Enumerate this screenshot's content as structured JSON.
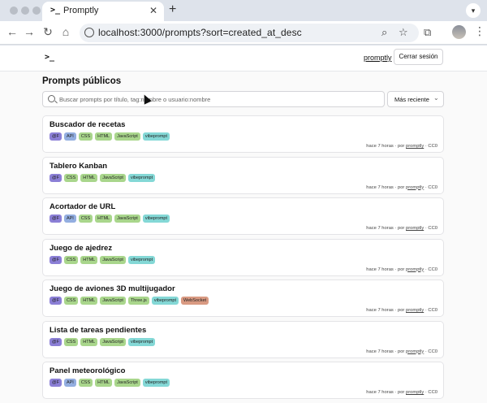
{
  "browser": {
    "tab_title": "Promptly",
    "tab_favicon": ">_",
    "url": "localhost:3000/prompts?sort=created_at_desc"
  },
  "header": {
    "logo": ">_",
    "user_link": "promptly",
    "logout_label": "Cerrar sesión"
  },
  "main": {
    "title": "Prompts públicos",
    "search_placeholder": "Buscar prompts por título, tag:nombre o usuario:nombre",
    "sort_label": "Más reciente"
  },
  "tag_colors": {
    "@F": "#8b7fd6",
    "API": "#93aee0",
    "CSS": "#a9d68c",
    "HTML": "#a9d68c",
    "JavaScript": "#a9d68c",
    "Three.js": "#a9d68c",
    "vibeprompt": "#84d8d6",
    "WebSocket": "#d99a82"
  },
  "prompts": [
    {
      "title": "Buscador de recetas",
      "tags": [
        "@F",
        "API",
        "CSS",
        "HTML",
        "JavaScript",
        "vibeprompt"
      ],
      "time": "hace 7 horas",
      "by": "por",
      "author": "promptly",
      "license": "CC0"
    },
    {
      "title": "Tablero Kanban",
      "tags": [
        "@F",
        "CSS",
        "HTML",
        "JavaScript",
        "vibeprompt"
      ],
      "time": "hace 7 horas",
      "by": "por",
      "author": "promptly",
      "license": "CC0"
    },
    {
      "title": "Acortador de URL",
      "tags": [
        "@F",
        "API",
        "CSS",
        "HTML",
        "JavaScript",
        "vibeprompt"
      ],
      "time": "hace 7 horas",
      "by": "por",
      "author": "promptly",
      "license": "CC0"
    },
    {
      "title": "Juego de ajedrez",
      "tags": [
        "@F",
        "CSS",
        "HTML",
        "JavaScript",
        "vibeprompt"
      ],
      "time": "hace 7 horas",
      "by": "por",
      "author": "promptly",
      "license": "CC0"
    },
    {
      "title": "Juego de aviones 3D multijugador",
      "tags": [
        "@F",
        "CSS",
        "HTML",
        "JavaScript",
        "Three.js",
        "vibeprompt",
        "WebSocket"
      ],
      "time": "hace 7 horas",
      "by": "por",
      "author": "promptly",
      "license": "CC0"
    },
    {
      "title": "Lista de tareas pendientes",
      "tags": [
        "@F",
        "CSS",
        "HTML",
        "JavaScript",
        "vibeprompt"
      ],
      "time": "hace 7 horas",
      "by": "por",
      "author": "promptly",
      "license": "CC0"
    },
    {
      "title": "Panel meteorológico",
      "tags": [
        "@F",
        "API",
        "CSS",
        "HTML",
        "JavaScript",
        "vibeprompt"
      ],
      "time": "hace 7 horas",
      "by": "por",
      "author": "promptly",
      "license": "CC0"
    }
  ]
}
